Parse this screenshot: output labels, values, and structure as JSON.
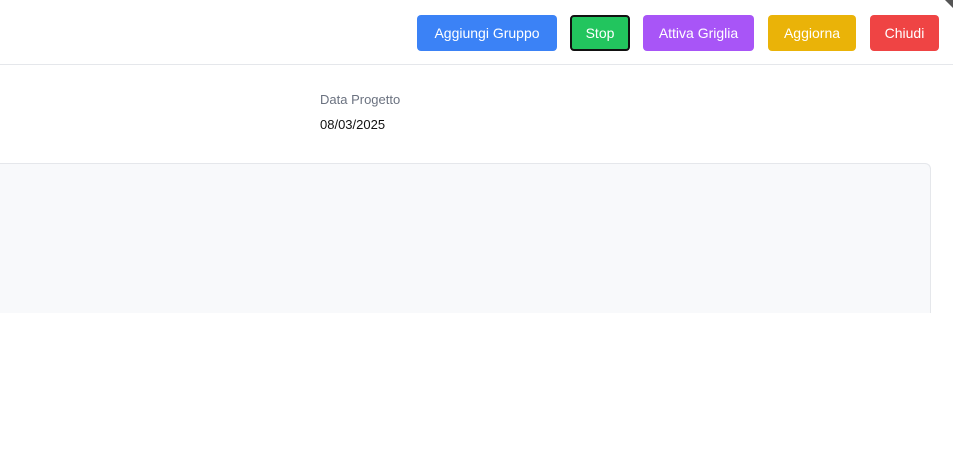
{
  "toolbar": {
    "add_group_label": "Aggiungi Gruppo",
    "stop_label": "Stop",
    "grid_label": "Attiva Griglia",
    "refresh_label": "Aggiorna",
    "close_label": "Chiudi"
  },
  "project": {
    "date_label": "Data Progetto",
    "date_value": "08/03/2025"
  },
  "colors": {
    "add_group": "#3b82f6",
    "stop": "#22c55e",
    "grid": "#a855f7",
    "refresh": "#eab308",
    "close": "#ef4444"
  }
}
